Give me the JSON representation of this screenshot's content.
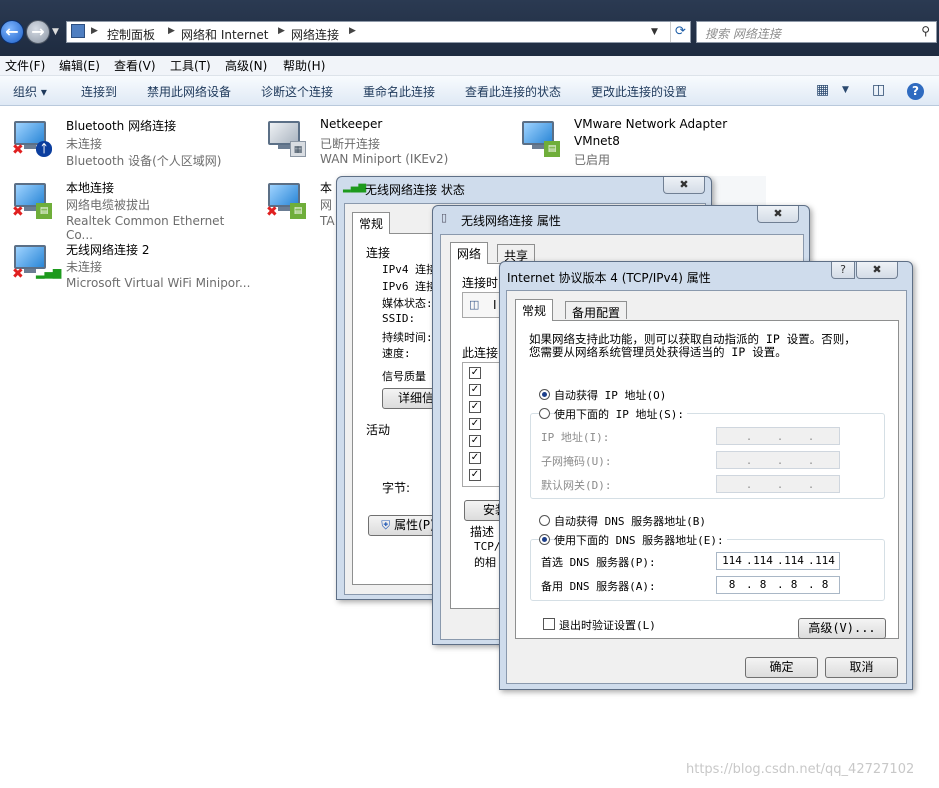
{
  "explorer": {
    "breadcrumbs": [
      "控制面板",
      "网络和 Internet",
      "网络连接"
    ],
    "search_placeholder": "搜索 网络连接",
    "menus": [
      "文件(F)",
      "编辑(E)",
      "查看(V)",
      "工具(T)",
      "高级(N)",
      "帮助(H)"
    ],
    "commands": [
      "组织 ▾",
      "连接到",
      "禁用此网络设备",
      "诊断这个连接",
      "重命名此连接",
      "查看此连接的状态",
      "更改此连接的设置"
    ],
    "connections": [
      {
        "name": "Bluetooth 网络连接",
        "status": "未连接",
        "device": "Bluetooth 设备(个人区域网)",
        "icon": "bluetooth-icon"
      },
      {
        "name": "Netkeeper",
        "status": "已断开连接",
        "device": "WAN Miniport (IKEv2)",
        "icon": "wan-server-icon"
      },
      {
        "name": "VMware Network Adapter",
        "status": "VMnet8",
        "device": "已启用",
        "icon": "network-cable-icon"
      },
      {
        "name": "本地连接",
        "status": "网络电缆被拔出",
        "device": "Realtek Common Ethernet Co...",
        "icon": "network-cable-icon"
      },
      {
        "name": "本",
        "status": "网",
        "device": "TA",
        "icon": "network-cable-icon"
      },
      {
        "name": "无线网络连接 2",
        "status": "未连接",
        "device": "Microsoft Virtual WiFi Minipor...",
        "icon": "signal-bars-icon"
      }
    ]
  },
  "status_dialog": {
    "title": "无线网络连接 状态",
    "tab": "常规",
    "section_connection": "连接",
    "rows": [
      "IPv4 连接",
      "IPv6 连接",
      "媒体状态:",
      "SSID:",
      "持续时间:",
      "速度:"
    ],
    "signal_label": "信号质量",
    "details_button": "详细信息",
    "section_activity": "活动",
    "bytes_label": "字节:",
    "properties_button": "属性(P)"
  },
  "props_dialog": {
    "title": "无线网络连接 属性",
    "tabs": [
      "网络",
      "共享"
    ],
    "connect_using": "连接时",
    "adapter_fragment": "I",
    "items_label": "此连接",
    "install_button": "安装",
    "desc_label": "描述",
    "desc_lines": [
      "TCP/",
      "的相"
    ]
  },
  "ipv4_dialog": {
    "title": "Internet 协议版本 4 (TCP/IPv4) 属性",
    "help": "?",
    "tabs": [
      "常规",
      "备用配置"
    ],
    "intro_line1": "如果网络支持此功能，则可以获取自动指派的 IP 设置。否则，",
    "intro_line2": "您需要从网络系统管理员处获得适当的 IP 设置。",
    "radio_auto_ip": "自动获得 IP 地址(O)",
    "radio_manual_ip": "使用下面的 IP 地址(S):",
    "ip_label": "IP 地址(I):",
    "mask_label": "子网掩码(U):",
    "gateway_label": "默认网关(D):",
    "radio_auto_dns": "自动获得 DNS 服务器地址(B)",
    "radio_manual_dns": "使用下面的 DNS 服务器地址(E):",
    "preferred_dns_label": "首选 DNS 服务器(P):",
    "alternate_dns_label": "备用 DNS 服务器(A):",
    "preferred_dns": [
      "114",
      "114",
      "114",
      "114"
    ],
    "alternate_dns": [
      "8",
      "8",
      "8",
      "8"
    ],
    "validate_label": "退出时验证设置(L)",
    "advanced_button": "高级(V)...",
    "ok_button": "确定",
    "cancel_button": "取消",
    "selected_ip_mode": "auto",
    "selected_dns_mode": "manual"
  },
  "watermark": "https://blog.csdn.net/qq_42727102"
}
